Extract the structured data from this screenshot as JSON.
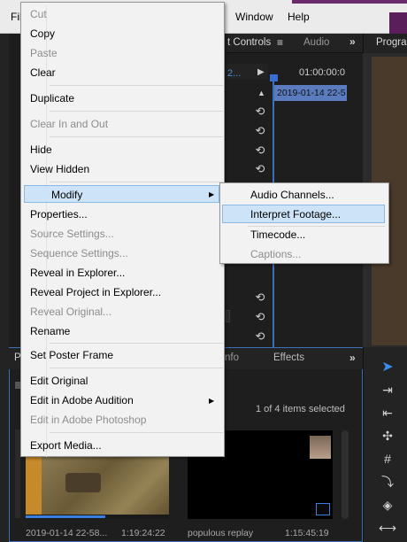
{
  "menubar": {
    "file": "Fil",
    "window": "Window",
    "help": "Help"
  },
  "effect_controls": {
    "tab_label": "t Controls",
    "menu_icon": "hamburger-icon",
    "audio_tab": "Audio",
    "blue_text": "2...",
    "timecode": "01:00:00:0",
    "clip_label": "2019-01-14 22-5"
  },
  "program": {
    "tab_label": "Program"
  },
  "context_menu": {
    "items": [
      {
        "label": "Cut",
        "disabled": true
      },
      {
        "label": "Copy",
        "disabled": false
      },
      {
        "label": "Paste",
        "disabled": true
      },
      {
        "label": "Clear",
        "disabled": false
      },
      {
        "label": "Duplicate",
        "disabled": false
      },
      {
        "label": "Clear In and Out",
        "disabled": true
      },
      {
        "label": "Hide",
        "disabled": false
      },
      {
        "label": "View Hidden",
        "disabled": false
      },
      {
        "label": "Modify",
        "disabled": false,
        "highlighted": true,
        "submenu": true
      },
      {
        "label": "Properties...",
        "disabled": false
      },
      {
        "label": "Source Settings...",
        "disabled": true
      },
      {
        "label": "Sequence Settings...",
        "disabled": true
      },
      {
        "label": "Reveal in Explorer...",
        "disabled": false
      },
      {
        "label": "Reveal Project in Explorer...",
        "disabled": false
      },
      {
        "label": "Reveal Original...",
        "disabled": true
      },
      {
        "label": "Rename",
        "disabled": false
      },
      {
        "label": "Set Poster Frame",
        "disabled": false
      },
      {
        "label": "Edit Original",
        "disabled": false
      },
      {
        "label": "Edit in Adobe Audition",
        "disabled": false,
        "submenu": true
      },
      {
        "label": "Edit in Adobe Photoshop",
        "disabled": true
      },
      {
        "label": "Export Media...",
        "disabled": false
      }
    ]
  },
  "submenu": {
    "items": [
      {
        "label": "Audio Channels...",
        "disabled": false
      },
      {
        "label": "Interpret Footage...",
        "disabled": false,
        "highlighted": true
      },
      {
        "label": "Timecode...",
        "disabled": false
      },
      {
        "label": "Captions...",
        "disabled": true
      }
    ]
  },
  "project_panel": {
    "tab_p": "P",
    "tab_info": "nfo",
    "tab_effects": "Effects",
    "items_count": "1 of 4 items selected",
    "clips": [
      {
        "name": "2019-01-14 22-58...",
        "duration": "1:19:24:22"
      },
      {
        "name": "populous replay",
        "duration": "1:15:45:19"
      }
    ]
  },
  "tools": [
    "selection-tool-icon",
    "track-select-icon",
    "ripple-edit-icon",
    "rolling-edit-icon",
    "rate-stretch-icon",
    "razor-icon",
    "slip-icon",
    "slide-icon"
  ]
}
